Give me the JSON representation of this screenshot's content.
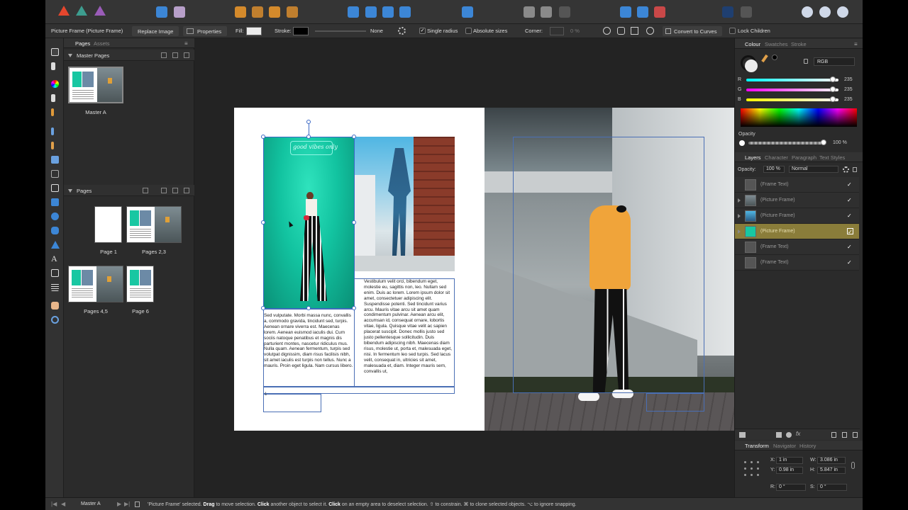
{
  "toolbar": {
    "personas": [
      "designer-persona",
      "pixel-persona",
      "export-persona"
    ]
  },
  "context": {
    "selection_label": "Picture Frame  (Picture Frame)",
    "replace_image": "Replace Image",
    "properties": "Properties",
    "fill_label": "Fill:",
    "stroke_label": "Stroke:",
    "stroke_none": "None",
    "single_radius": "Single radius",
    "absolute_sizes": "Absolute sizes",
    "corner_label": "Corner:",
    "corner_value": "0 %",
    "convert_to_curves": "Convert to Curves",
    "lock_children": "Lock Children"
  },
  "left_panel": {
    "tabs": [
      "Pages",
      "Assets"
    ],
    "master_section": "Master Pages",
    "master_label": "Master A",
    "pages_section": "Pages",
    "pages": [
      {
        "label": "Page 1"
      },
      {
        "label": "Pages 2,3"
      },
      {
        "label": "Pages 4,5"
      },
      {
        "label": "Page 6"
      }
    ]
  },
  "document": {
    "left_text": "Sed vulputate. Morbi massa nunc, convallis a, commodo gravida, tincidunt sed, turpis. Aenean ornare viverra est. Maecenas lorem. Aenean euismod iaculis dui. Cum sociis natoque penatibus et magnis dis parturient montes, nascetur ridiculus mus. Nulla quam. Aenean fermentum, turpis sed volutpat dignissim, diam risus facilisis nibh, sit amet iaculis est turpis non tellus. Nunc a mauris. Proin eget ligula. Nam cursus libero.",
    "right_text": "Vestibulum velit orci, bibendum eget, molestie eu, sagittis non, leo. Nullam sed enim. Duis ac lorem. Lorem ipsum dolor sit amet, consectetuer adipiscing elit. Suspendisse potenti. Sed tincidunt varius arcu. Mauris vitae arcu sit amet quam condimentum pulvinar. Aenean arcu elit, accumsan id, consequat ornare, lobortis vitae, ligula. Quisque vitae velit ac sapien placerat suscipit. Donec mollis justo sed justo pellentesque sollicitudin. Duis bibendum adipiscing nibh. Maecenas diam risus, molestie ut, porta et, malesuada eget, nisi. In fermentum leo sed turpis. Sed lacus velit, consequat in, ultricies sit amet, malesuada et, diam. Integer mauris sem, convallis ut,",
    "neon_sign": "good vibes only",
    "caption_marker": "1"
  },
  "colour_panel": {
    "tabs": [
      "Colour",
      "Swatches",
      "Stroke"
    ],
    "model": "RGB",
    "r": "235",
    "g": "235",
    "b": "235",
    "r_label": "R",
    "g_label": "G",
    "b_label": "B",
    "opacity_label": "Opacity",
    "opacity_value": "100 %",
    "fill_color": "#ebebeb"
  },
  "layers_panel": {
    "tabs": [
      "Layers",
      "Character",
      "Paragraph",
      "Text Styles"
    ],
    "opacity_label": "Opacity:",
    "opacity_value": "100 %",
    "blend_mode": "Normal",
    "layers": [
      {
        "name": "(Frame Text)",
        "kind": "text",
        "selected": false,
        "check": "✓"
      },
      {
        "name": "(Picture Frame)",
        "kind": "picture",
        "selected": false,
        "check": "✓"
      },
      {
        "name": "(Picture Frame)",
        "kind": "picture",
        "selected": false,
        "check": "✓"
      },
      {
        "name": "(Picture Frame)",
        "kind": "picture-teal",
        "selected": true,
        "check": "✓"
      },
      {
        "name": "(Frame Text)",
        "kind": "text",
        "selected": false,
        "check": "✓"
      },
      {
        "name": "(Frame Text)",
        "kind": "text",
        "selected": false,
        "check": "✓"
      }
    ]
  },
  "transform_panel": {
    "tabs": [
      "Transform",
      "Navigator",
      "History"
    ],
    "x_label": "X:",
    "x": "1 in",
    "y_label": "Y:",
    "y": "0.98 in",
    "w_label": "W:",
    "w": "3.086 in",
    "h_label": "H:",
    "h": "5.847 in",
    "r_label": "R:",
    "r": "0 °",
    "s_label": "S:",
    "s": "0 °"
  },
  "status": {
    "page": "Master A",
    "msg_prefix": "'Picture Frame' selected. ",
    "drag": "Drag",
    "msg1": " to move selection. ",
    "click": "Click",
    "msg2": " another object to select it. ",
    "click2": "Click",
    "msg3": " on an empty area to deselect selection. ⇧ to constrain. ⌘ to clone selected objects. ⌥ to ignore snapping."
  }
}
